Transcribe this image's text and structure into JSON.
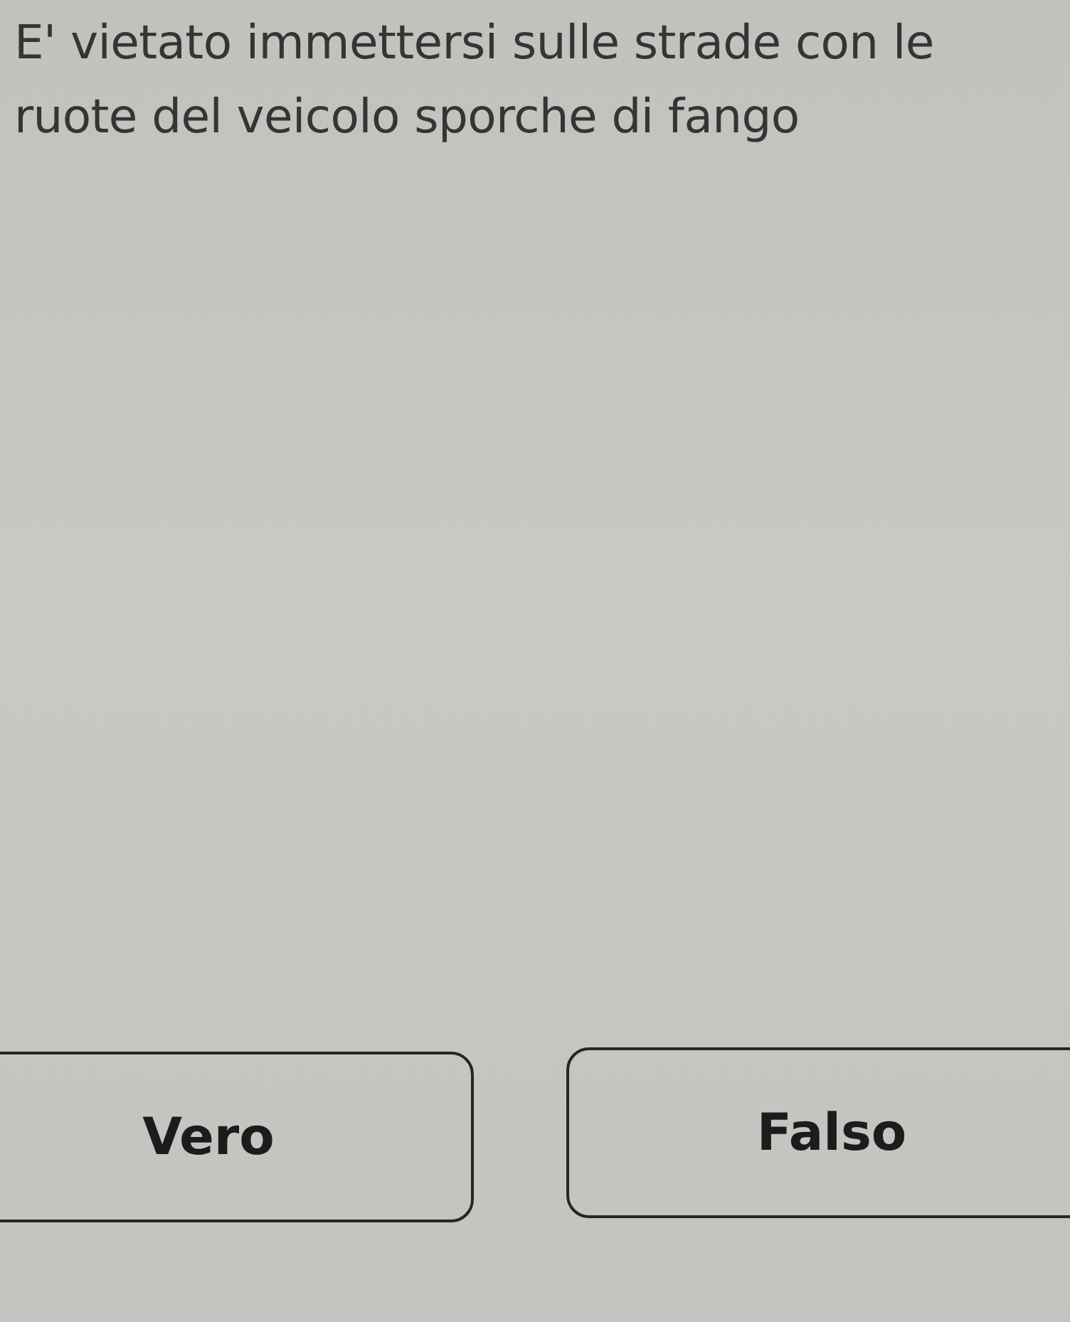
{
  "question": {
    "text": "E' vietato immettersi sulle strade con le ruote del veicolo sporche di fango"
  },
  "answers": [
    {
      "label": "Vero",
      "selected": false
    },
    {
      "label": "Falso",
      "selected": false
    }
  ]
}
